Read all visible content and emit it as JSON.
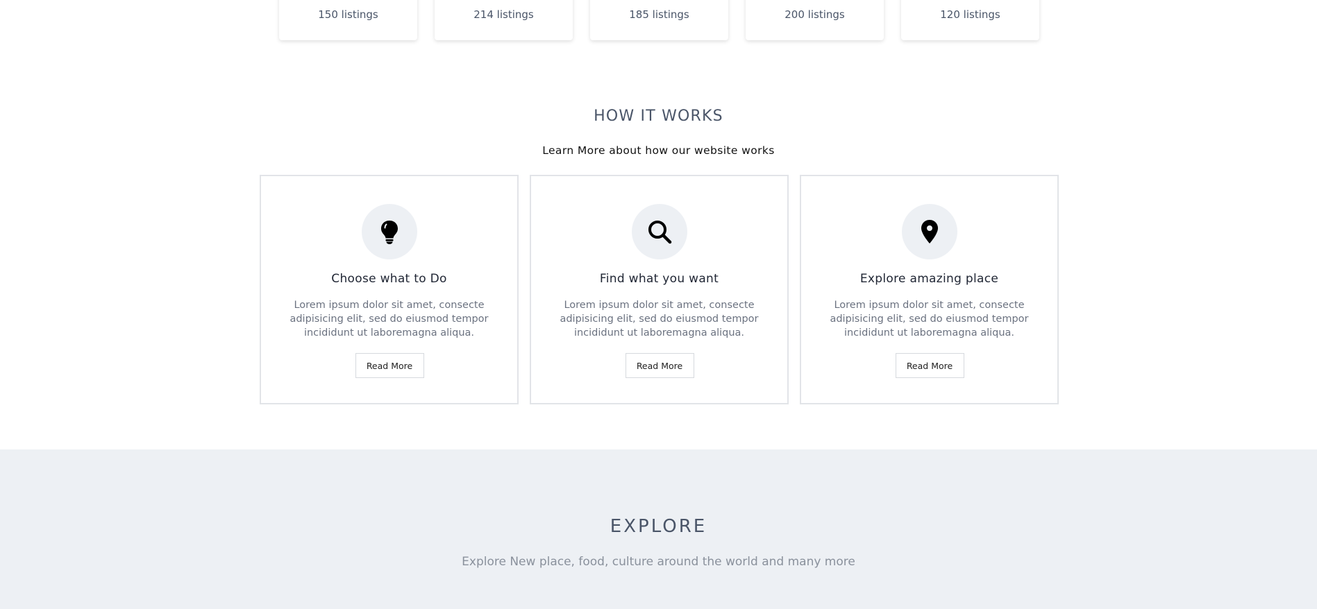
{
  "listings": [
    {
      "label": "150 listings"
    },
    {
      "label": "214 listings"
    },
    {
      "label": "185 listings"
    },
    {
      "label": "200 listings"
    },
    {
      "label": "120 listings"
    }
  ],
  "how_it_works": {
    "title": "HOW IT WORKS",
    "subtitle": "Learn More about how our website works",
    "steps": [
      {
        "icon": "lightbulb-icon",
        "title": "Choose what to Do",
        "text": "Lorem ipsum dolor sit amet, consecte adipisicing elit, sed do eiusmod tempor incididunt ut laboremagna aliqua.",
        "button": "Read More"
      },
      {
        "icon": "search-icon",
        "title": "Find what you want",
        "text": "Lorem ipsum dolor sit amet, consecte adipisicing elit, sed do eiusmod tempor incididunt ut laboremagna aliqua.",
        "button": "Read More"
      },
      {
        "icon": "map-pin-icon",
        "title": "Explore amazing place",
        "text": "Lorem ipsum dolor sit amet, consecte adipisicing elit, sed do eiusmod tempor incididunt ut laboremagna aliqua.",
        "button": "Read More"
      }
    ]
  },
  "explore": {
    "title": "EXPLORE",
    "subtitle": "Explore New place, food, culture around the world and many more"
  },
  "colors": {
    "section_bg": "#edf0f4",
    "heading": "#4a5568",
    "card_border": "#e2e4e8"
  }
}
